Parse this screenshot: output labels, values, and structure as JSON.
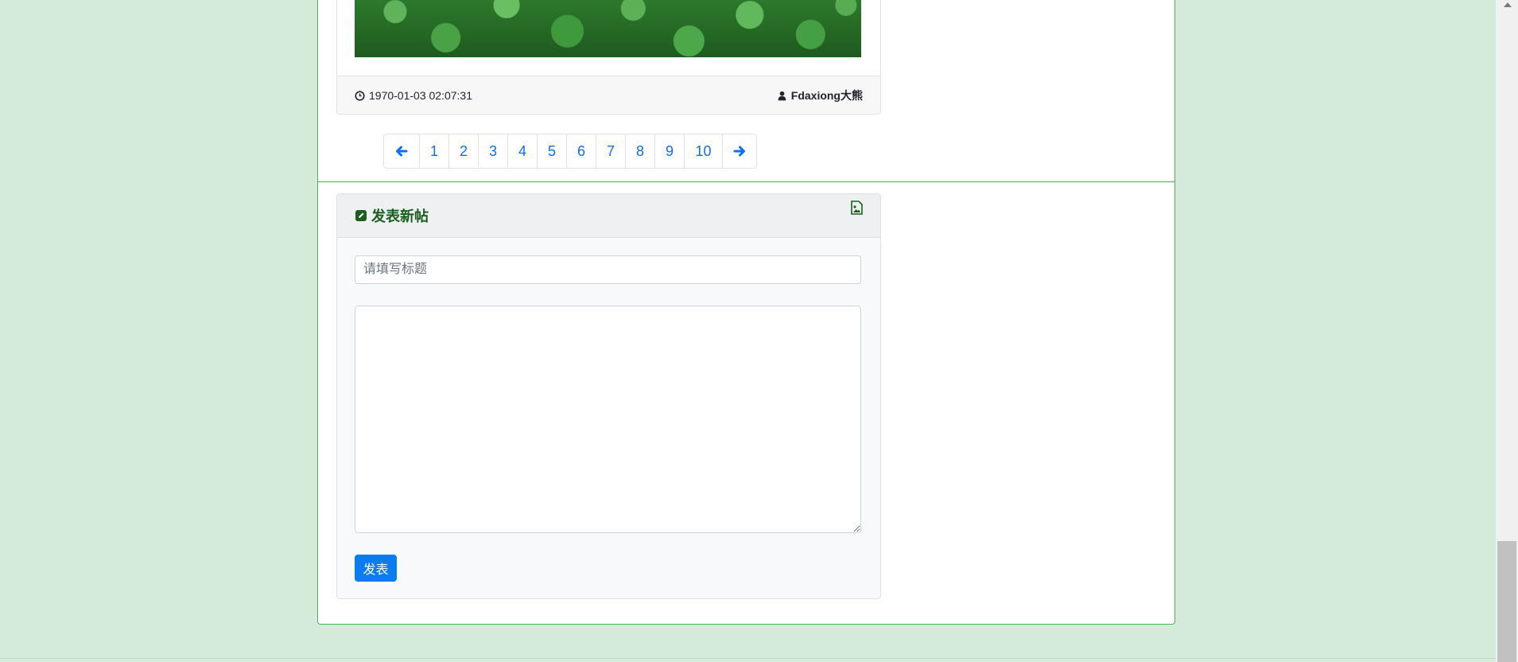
{
  "post": {
    "timestamp": "1970-01-03 02:07:31",
    "author": "Fdaxiong大熊"
  },
  "pagination": {
    "prev_icon": "arrow-left-icon",
    "next_icon": "arrow-right-icon",
    "pages": [
      "1",
      "2",
      "3",
      "4",
      "5",
      "6",
      "7",
      "8",
      "9",
      "10"
    ]
  },
  "new_post": {
    "title": "发表新帖",
    "title_placeholder": "请填写标题",
    "content_value": "",
    "submit_label": "发表",
    "header_icon": "edit-icon",
    "image_icon": "image-file-icon"
  },
  "colors": {
    "background": "#d4ebdb",
    "accent_green": "#4caf50",
    "header_green": "#1b5e20",
    "link_blue": "#0d6efd",
    "button_blue": "#0d7cf2"
  }
}
